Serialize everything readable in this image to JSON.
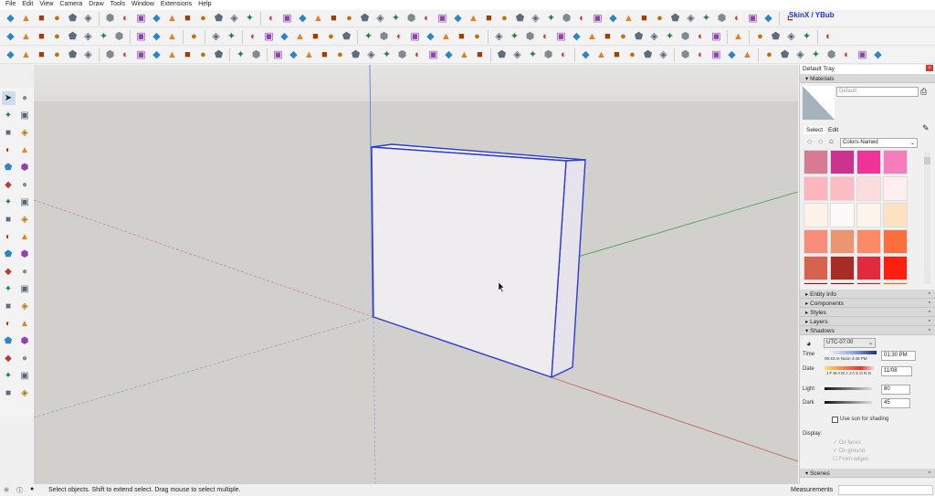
{
  "menu": [
    "File",
    "Edit",
    "View",
    "Camera",
    "Draw",
    "Tools",
    "Window",
    "Extensions",
    "Help"
  ],
  "toolbar": {
    "row1": [
      "tour-guide-icon",
      "play-icon",
      "stop-icon",
      "prev-icon",
      "hand-icon",
      "joystick-icon",
      "sep",
      "vertex-tools-icon",
      "spline-icon",
      "rotate-icon",
      "line-icon",
      "cloud-icon",
      "shape-icon",
      "curve-icon",
      "cake-icon",
      "camera-icon",
      "arc-icon",
      "sep",
      "shape2-icon",
      "shape3-icon",
      "shape4-icon",
      "shape5-icon",
      "shape6-icon",
      "shape7-icon",
      "shape8-icon",
      "shape9-icon",
      "shape10-icon",
      "shape11-icon",
      "shape12-icon",
      "shape13-icon",
      "shape14-icon",
      "shape15-icon",
      "shape16-icon",
      "shape17-icon",
      "shape18-icon",
      "shape19-icon",
      "shape20-icon",
      "shape21-icon",
      "shape22-icon",
      "shape23-icon",
      "shape24-icon",
      "shape25-icon",
      "shape26-icon",
      "shape27-icon",
      "shape28-icon",
      "shape29-icon",
      "shape30-icon",
      "shape31-icon",
      "shape32-icon",
      "shape33-icon",
      "shape34-icon",
      "sep",
      "render-icon"
    ],
    "row2": [
      "push-pull-icon",
      "push-pull-e-icon",
      "push-pull-j-icon",
      "push-pull-r-icon",
      "push-pull-v-icon",
      "push-pull-n-icon",
      "push-pull-x-icon",
      "push-pull-f-icon",
      "sep",
      "plank-icon",
      "curve-tool-icon",
      "grid-icon",
      "sep",
      "panel-icon",
      "sep",
      "terrain-icon",
      "star-icon",
      "sep",
      "rock-icon",
      "tool1-icon",
      "tool2-icon",
      "tool3-icon",
      "tool4-icon",
      "tool5-icon",
      "tool6-icon",
      "sep",
      "tool7-icon",
      "tool8-icon",
      "tool9-icon",
      "tool10-icon",
      "tool11-icon",
      "tool12-icon",
      "tool13-icon",
      "tool14-icon",
      "sep",
      "box-icon",
      "box2-icon",
      "box3-icon",
      "box4-icon",
      "box5-icon",
      "box6-icon",
      "box7-icon",
      "box8-icon",
      "box9-icon",
      "box10-icon",
      "box11-icon",
      "box12-icon",
      "box13-icon",
      "box14-icon",
      "box15-icon",
      "sep",
      "scene-icon",
      "sep",
      "play-icon",
      "stop-icon",
      "tool15-icon",
      "tool16-icon",
      "sep",
      "settings-icon"
    ],
    "row3": [
      "solid-icon",
      "solid2-icon",
      "solid3-icon",
      "solid4-icon",
      "sword-icon",
      "solid5-icon",
      "sep",
      "sandbox1-icon",
      "sandbox2-icon",
      "sandbox3-icon",
      "sandbox4-icon",
      "sandbox5-icon",
      "sandbox6-icon",
      "sandbox7-icon",
      "sandbox8-icon",
      "sep",
      "coin-icon",
      "gear-icon",
      "sep",
      "shape-a-icon",
      "shape-b-icon",
      "shape-c-icon",
      "shape-d-icon",
      "shape-e-icon",
      "shape-f-icon",
      "shape-g-icon",
      "shape-h-icon",
      "shape-i-icon",
      "shape-j-icon",
      "shape-k-icon",
      "shape-l-icon",
      "shape-m-icon",
      "shape-n-icon",
      "sep",
      "shape-o-icon",
      "shape-p-icon",
      "shape-q-icon",
      "shape-r-icon",
      "shape-s-icon",
      "sep",
      "shape-t-icon",
      "shape-u-icon",
      "shape-v-icon",
      "shape-w-icon",
      "shape-x-icon",
      "shape-y-icon",
      "sep",
      "shape-z-icon",
      "box-a-icon",
      "box-b-icon",
      "plant-icon",
      "leaf-icon",
      "sep",
      "table-icon",
      "circle-icon",
      "triangle-icon",
      "stool-icon",
      "light-icon",
      "dome-icon",
      "target-icon",
      "ruler-icon"
    ],
    "skin_label": "SkinX / YBub"
  },
  "left_tools": [
    "select-icon",
    "eraser-icon",
    "paint-bucket-icon",
    "eraser2-icon",
    "pencil-icon",
    "freehand-icon",
    "rectangle-icon",
    "rotated-rect-icon",
    "circle-icon",
    "polygon-icon",
    "arc-icon",
    "pie-icon",
    "arc2-icon",
    "arc3-icon",
    "move-icon",
    "push-pull-icon",
    "rotate-icon",
    "follow-me-icon",
    "scale-icon",
    "offset-icon",
    "tape-measure-icon",
    "dimension-icon",
    "protractor-icon",
    "text-icon",
    "axes-icon",
    "3d-text-icon",
    "orbit-icon",
    "pan-icon",
    "zoom-icon",
    "zoom-window-icon",
    "zoom-extents-icon",
    "prev-view-icon",
    "position-camera-icon",
    "look-around-icon",
    "walk-icon",
    "section-plane-icon"
  ],
  "tray": {
    "title": "Default Tray",
    "materials": {
      "title": "Materials",
      "name": "Default",
      "tab_select": "Select",
      "tab_edit": "Edit",
      "library": "Colors-Named",
      "swatches": [
        "#d97a95",
        "#cc3390",
        "#f03399",
        "#f57dbb",
        "#fbb6c0",
        "#fbbcc4",
        "#fcdcdc",
        "#fdeef0",
        "#fdf2e8",
        "#fdf9f8",
        "#fdf5ec",
        "#fde1c0",
        "#f98c7a",
        "#ea9673",
        "#fb8a65",
        "#fb6f3e",
        "#d9624f",
        "#a82c24",
        "#e12a3c",
        "#fb1f10",
        "#a01408",
        "#8c0f08",
        "#b0291c",
        "#fb6a10"
      ]
    },
    "panels": [
      "Entity Info",
      "Components",
      "Styles",
      "Layers"
    ],
    "shadows": {
      "title": "Shadows",
      "timezone": "UTC-07:00",
      "time_label": "Time",
      "time_marks": "06:43 AI  Noon  4:45 PM",
      "time_value": "01:30 PM",
      "date_label": "Date",
      "months": "J F M A M J J A S O N D",
      "date_value": "11/08",
      "light_label": "Light",
      "light_value": "80",
      "dark_label": "Dark",
      "dark_value": "45",
      "use_sun": "Use sun for shading",
      "display_label": "Display:",
      "on_faces": "On faces",
      "on_ground": "On ground",
      "from_edges": "From edges"
    },
    "scenes": "Scenes"
  },
  "status": {
    "message": "Select objects. Shift to extend select. Drag mouse to select multiple.",
    "measurements_label": "Measurements"
  },
  "colors": {
    "sky": "#e2e2e1",
    "ground": "#d1cfcb",
    "edge": "#2a3bd6",
    "face": "#eeecef"
  }
}
